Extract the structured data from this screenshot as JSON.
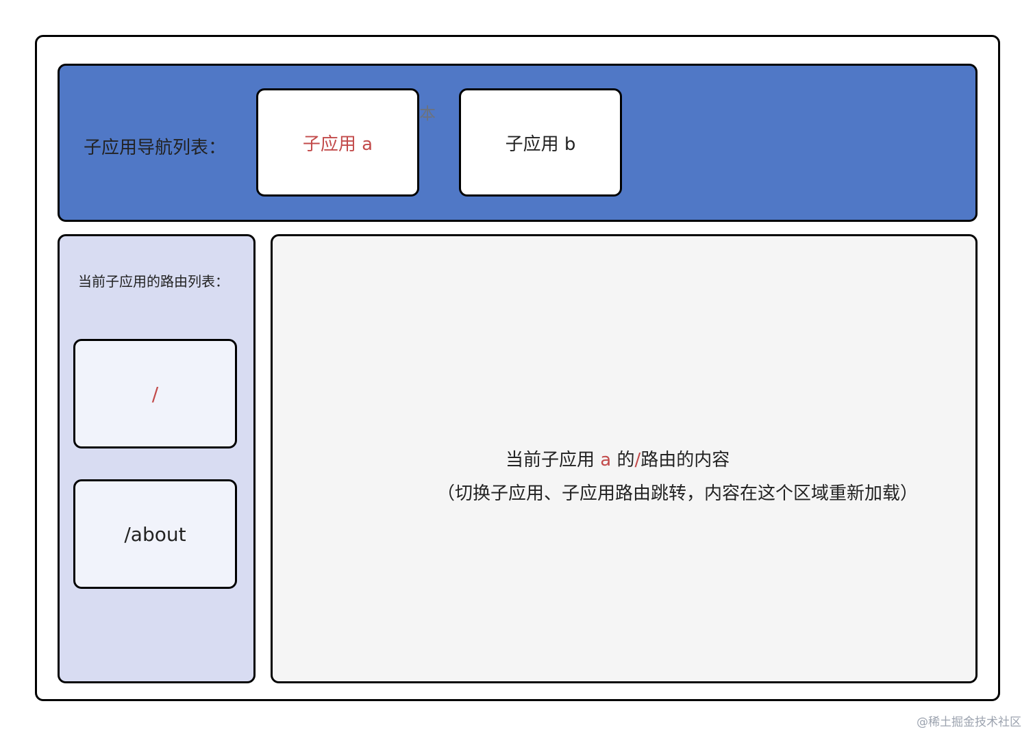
{
  "colors": {
    "nav_bg": "#5078c6",
    "route_panel_bg": "#d8dcf2",
    "route_item_bg": "#f1f3fb",
    "content_bg": "#f5f5f5",
    "highlight": "#c24a4a",
    "text": "#222222"
  },
  "nav": {
    "label": "子应用导航列表：",
    "app_a": {
      "prefix": "子应用 ",
      "suffix": "a"
    },
    "app_b": {
      "prefix": "子应用 ",
      "suffix": "b"
    },
    "stray_char": "本"
  },
  "route_list": {
    "label": "当前子应用的路由列表：",
    "items": [
      "/",
      "/about"
    ]
  },
  "content": {
    "line1": {
      "part1": "当前子应用 ",
      "app": "a",
      "part2": " 的",
      "route": "/",
      "part3": "路由的内容"
    },
    "line2": "（切换子应用、子应用路由跳转，内容在这个区域重新加载）"
  },
  "watermark": "@稀土掘金技术社区"
}
